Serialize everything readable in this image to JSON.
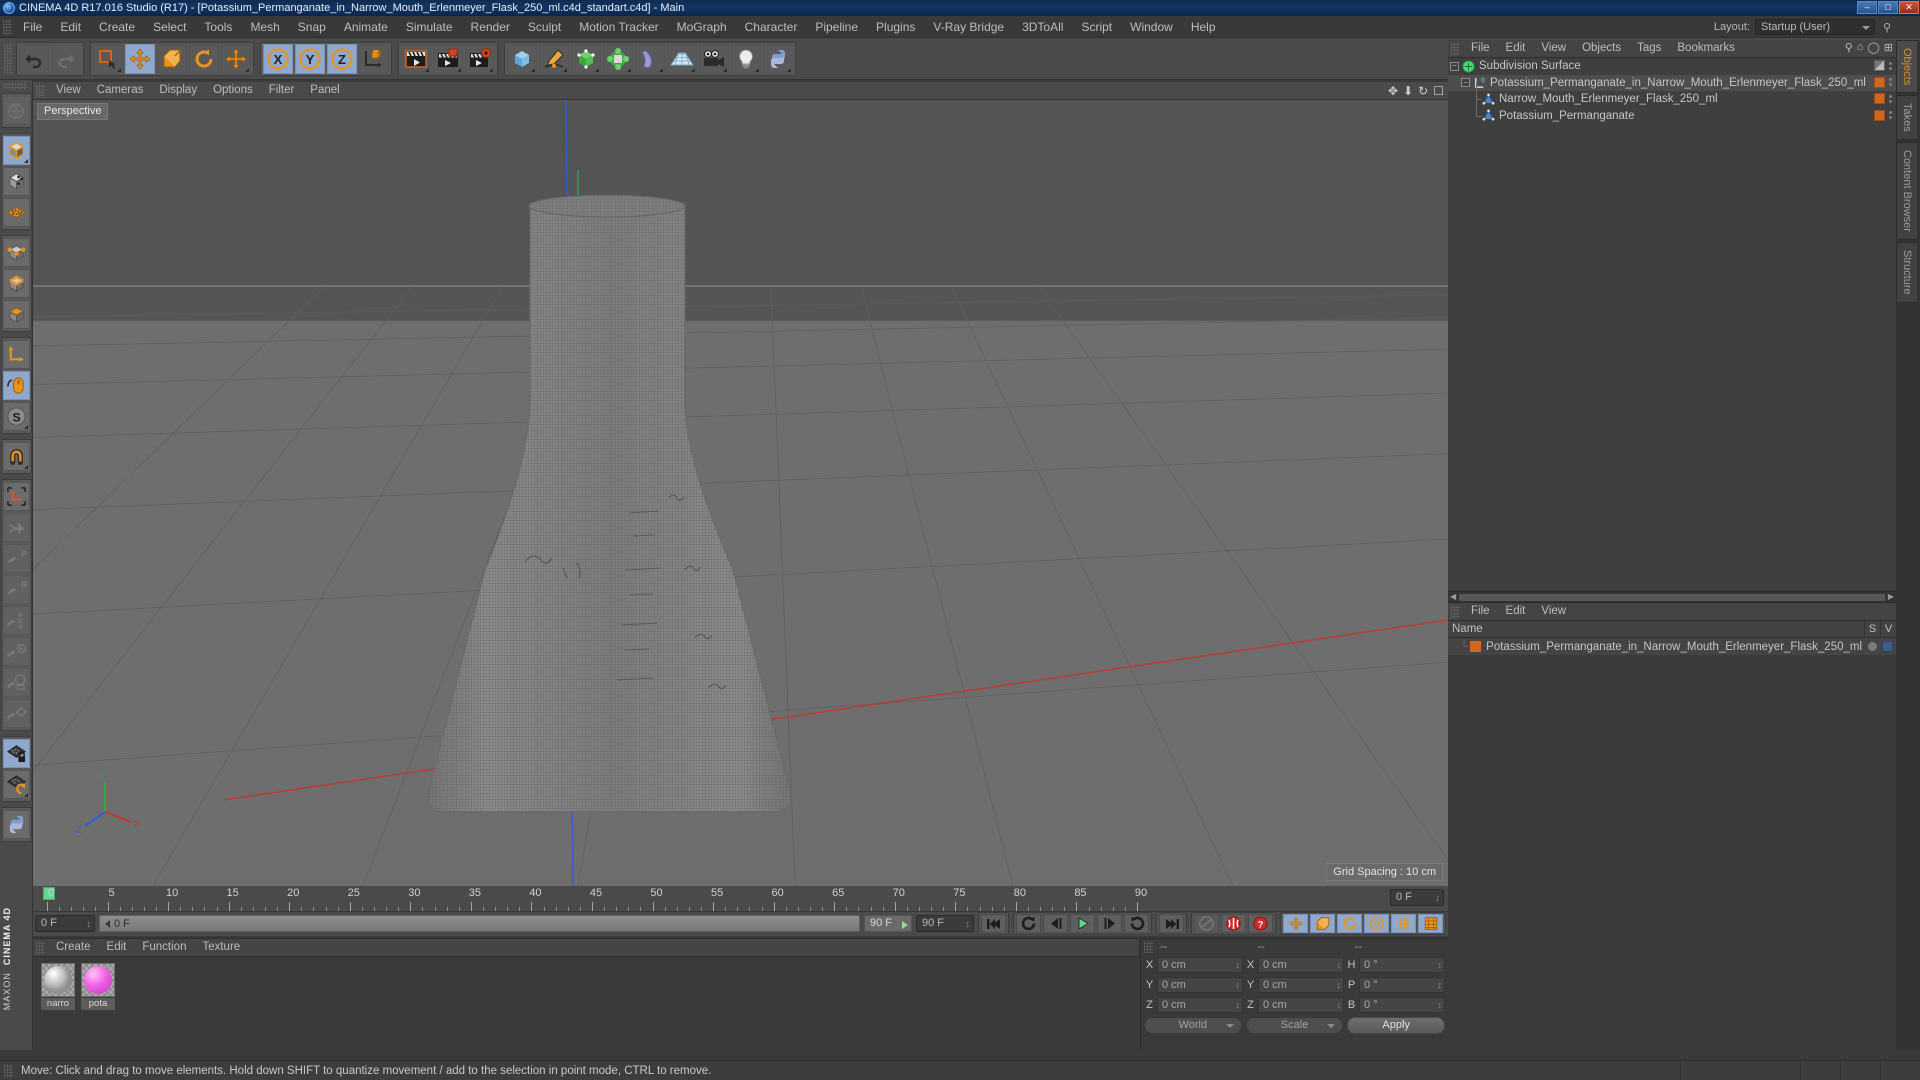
{
  "titlebar": {
    "text": "CINEMA 4D R17.016 Studio (R17) - [Potassium_Permanganate_in_Narrow_Mouth_Erlenmeyer_Flask_250_ml.c4d_standart.c4d] - Main",
    "minimize": "–",
    "maximize": "□",
    "close": "✕"
  },
  "menubar": {
    "items": [
      "File",
      "Edit",
      "Create",
      "Select",
      "Tools",
      "Mesh",
      "Snap",
      "Animate",
      "Simulate",
      "Render",
      "Sculpt",
      "Motion Tracker",
      "MoGraph",
      "Character",
      "Pipeline",
      "Plugins",
      "V-Ray Bridge",
      "3DToAll",
      "Script",
      "Window",
      "Help"
    ],
    "layout_label": "Layout:",
    "layout_value": "Startup (User)"
  },
  "viewport": {
    "menu": [
      "View",
      "Cameras",
      "Display",
      "Options",
      "Filter",
      "Panel"
    ],
    "label": "Perspective",
    "grid_spacing": "Grid Spacing : 10 cm",
    "axis_x": "X",
    "axis_y": "Y",
    "axis_z": "Z"
  },
  "object_manager": {
    "menu": [
      "File",
      "Edit",
      "View",
      "Objects",
      "Tags",
      "Bookmarks"
    ],
    "rows": [
      {
        "name": "Subdivision Surface",
        "icon": "subdivision-surface-icon",
        "depth": 0,
        "tag": "checker"
      },
      {
        "name": "Potassium_Permanganate_in_Narrow_Mouth_Erlenmeyer_Flask_250_ml",
        "icon": "null-object-icon",
        "depth": 1,
        "tag": "orange"
      },
      {
        "name": "Narrow_Mouth_Erlenmeyer_Flask_250_ml",
        "icon": "polygon-object-icon",
        "depth": 2,
        "tag": "orange"
      },
      {
        "name": "Potassium_Permanganate",
        "icon": "polygon-object-icon",
        "depth": 2,
        "tag": "orange"
      }
    ]
  },
  "layer_manager": {
    "menu": [
      "File",
      "Edit",
      "View"
    ],
    "column_name": "Name",
    "column_s": "S",
    "column_v": "V",
    "rows": [
      {
        "name": "Potassium_Permanganate_in_Narrow_Mouth_Erlenmeyer_Flask_250_ml"
      }
    ]
  },
  "vertical_tabs": [
    {
      "label": "Objects",
      "active": true
    },
    {
      "label": "Takes",
      "active": false
    },
    {
      "label": "Content Browser",
      "active": false
    },
    {
      "label": "Structure",
      "active": false
    }
  ],
  "timeline": {
    "ticks": [
      0,
      5,
      10,
      15,
      20,
      25,
      30,
      35,
      40,
      45,
      50,
      55,
      60,
      65,
      70,
      75,
      80,
      85,
      90
    ],
    "range_start": 0,
    "range_end": 90,
    "current_frame": "0 F",
    "current_frame_bar": "0 F",
    "preview_end": "90 F",
    "document_end": "90 F",
    "frame_field_right": "0 F"
  },
  "material_manager": {
    "menu": [
      "Create",
      "Edit",
      "Function",
      "Texture"
    ],
    "materials": [
      {
        "name": "narro",
        "color": "#cfcfcf",
        "type": "glass"
      },
      {
        "name": "pota",
        "color": "#f060e8",
        "type": "solid"
      }
    ]
  },
  "coordinates": {
    "headers": [
      "--",
      "--",
      "--"
    ],
    "position": {
      "label_x": "X",
      "label_y": "Y",
      "label_z": "Z",
      "x": "0 cm",
      "y": "0 cm",
      "z": "0 cm"
    },
    "size": {
      "label_x": "X",
      "label_y": "Y",
      "label_z": "Z",
      "x": "0 cm",
      "y": "0 cm",
      "z": "0 cm"
    },
    "rotation": {
      "label_h": "H",
      "label_p": "P",
      "label_b": "B",
      "h": "0 °",
      "p": "0 °",
      "b": "0 °"
    },
    "coord_system": "World",
    "mode": "Scale",
    "apply": "Apply"
  },
  "statusbar": {
    "message": "Move: Click and drag to move elements. Hold down SHIFT to quantize movement / add to the selection in point mode, CTRL to remove."
  },
  "colors": {
    "accent_orange": "#d2661f",
    "active_blue": "#8fa8cc",
    "tab_active": "#e08b28",
    "playhead_green": "#63d68f",
    "axis_x_red": "#c0392b",
    "axis_y_green": "#27ae60",
    "axis_z_blue": "#2f5fd0"
  }
}
